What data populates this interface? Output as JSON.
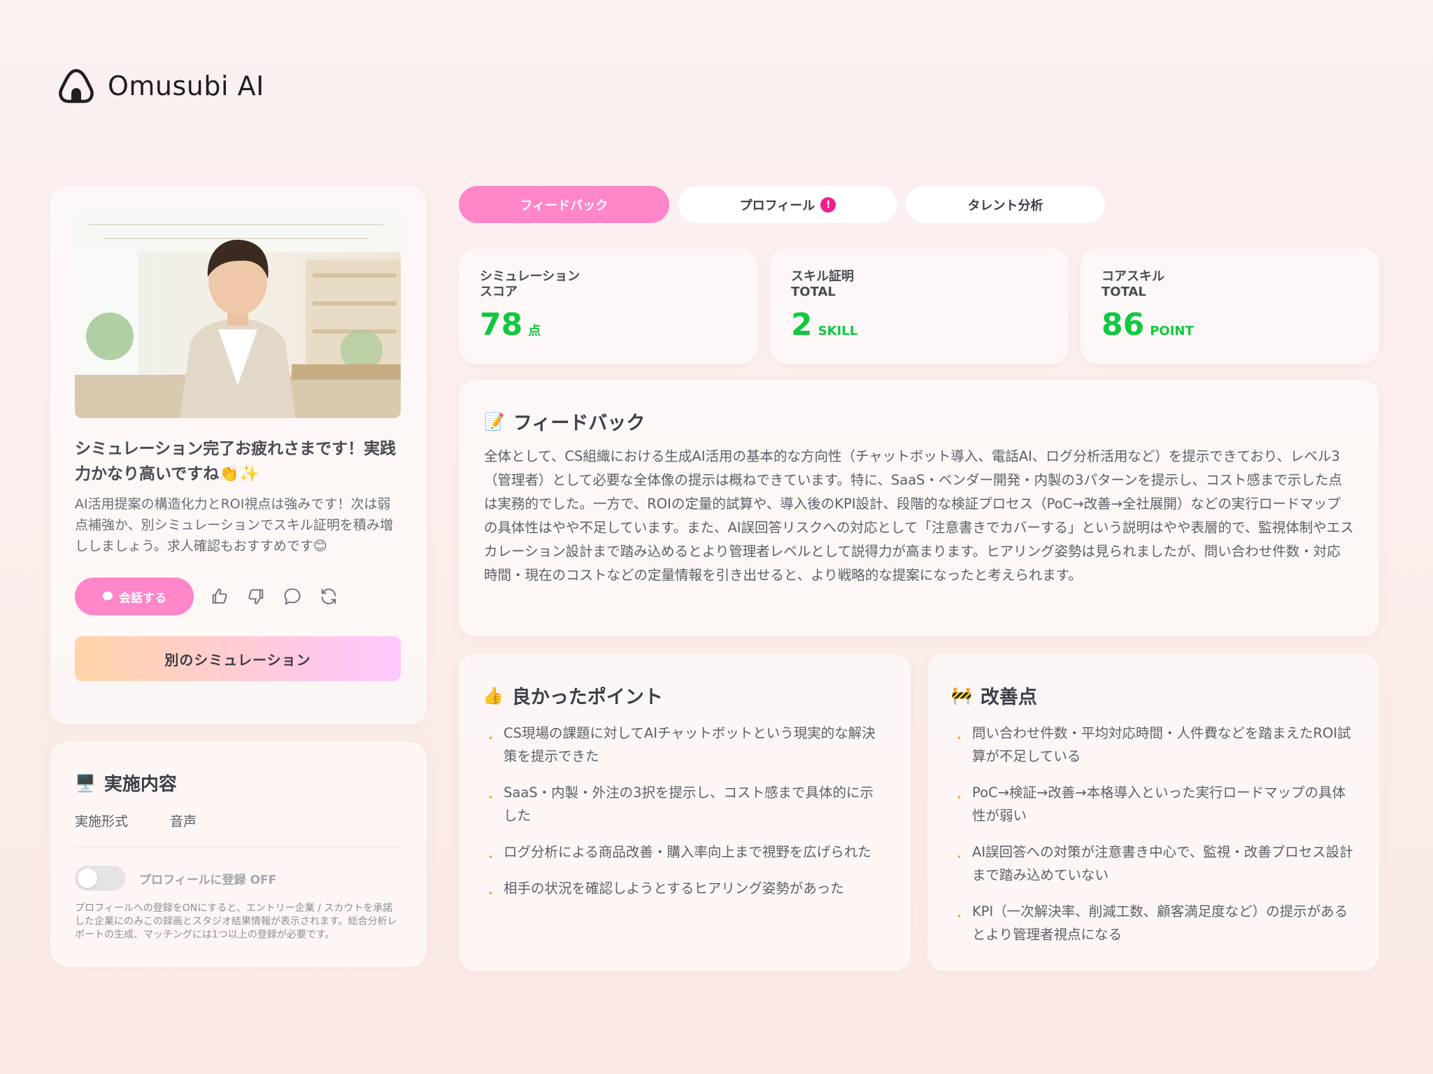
{
  "app": {
    "name": "Omusubi AI"
  },
  "profile": {
    "message_title": "シミュレーション完了お疲れさまです！実践力かなり高いですね👏✨",
    "message_body": "AI活用提案の構造化力とROI視点は強みです！次は弱点補強か、別シミュレーションでスキル証明を積み増ししましょう。求人確認もおすすめです😊",
    "talk_label": "会話する",
    "sim_button_label": "別のシミュレーション"
  },
  "implementation": {
    "title": "実施内容",
    "format_label": "実施形式",
    "format_value": "音声",
    "toggle_label": "プロフィールに登録 OFF",
    "note": "プロフィールへの登録をONにすると、エントリー企業 / スカウトを承諾した企業にのみこの録画とスタジオ結果情報が表示されます。総合分析レポートの生成、マッチングには1つ以上の登録が必要です。"
  },
  "tabs": [
    {
      "label": "フィードバック",
      "active": true
    },
    {
      "label": "プロフィール",
      "badge": "!"
    },
    {
      "label": "タレント分析"
    }
  ],
  "stats": [
    {
      "label_line1": "シミュレーション",
      "label_line2": "スコア",
      "value": "78",
      "unit": "点"
    },
    {
      "label_line1": "スキル証明",
      "label_line2": "TOTAL",
      "value": "2",
      "unit": "SKILL"
    },
    {
      "label_line1": "コアスキル",
      "label_line2": "TOTAL",
      "value": "86",
      "unit": "POINT"
    }
  ],
  "feedback": {
    "title": "フィードバック",
    "icon": "memo-icon",
    "body": "全体として、CS組織における生成AI活用の基本的な方向性（チャットボット導入、電話AI、ログ分析活用など）を提示できており、レベル3（管理者）として必要な全体像の提示は概ねできています。特に、SaaS・ベンダー開発・内製の3パターンを提示し、コスト感まで示した点は実務的でした。一方で、ROIの定量的試算や、導入後のKPI設計、段階的な検証プロセス（PoC→改善→全社展開）などの実行ロードマップの具体性はやや不足しています。また、AI誤回答リスクへの対応として「注意書きでカバーする」という説明はやや表層的で、監視体制やエスカレーション設計まで踏み込めるとより管理者レベルとして説得力が高まります。ヒアリング姿勢は見られましたが、問い合わせ件数・対応時間・現在のコストなどの定量情報を引き出せると、より戦略的な提案になったと考えられます。"
  },
  "good_points": {
    "title": "良かったポイント",
    "emoji": "👍",
    "items": [
      "CS現場の課題に対してAIチャットボットという現実的な解決策を提示できた",
      "SaaS・内製・外注の3択を提示し、コスト感まで具体的に示した",
      "ログ分析による商品改善・購入率向上まで視野を広げられた",
      "相手の状況を確認しようとするヒアリング姿勢があった"
    ]
  },
  "improvements": {
    "title": "改善点",
    "emoji": "🚧",
    "items": [
      "問い合わせ件数・平均対応時間・人件費などを踏まえたROI試算が不足している",
      "PoC→検証→改善→本格導入といった実行ロードマップの具体性が弱い",
      "AI誤回答への対策が注意書き中心で、監視・改善プロセス設計まで踏み込めていない",
      "KPI（一次解決率、削減工数、顧客満足度など）の提示があるとより管理者視点になる"
    ]
  },
  "colors": {
    "accent_pink": "#ff86c8",
    "score_green": "#10c940",
    "badge": "#ee1f8a"
  }
}
